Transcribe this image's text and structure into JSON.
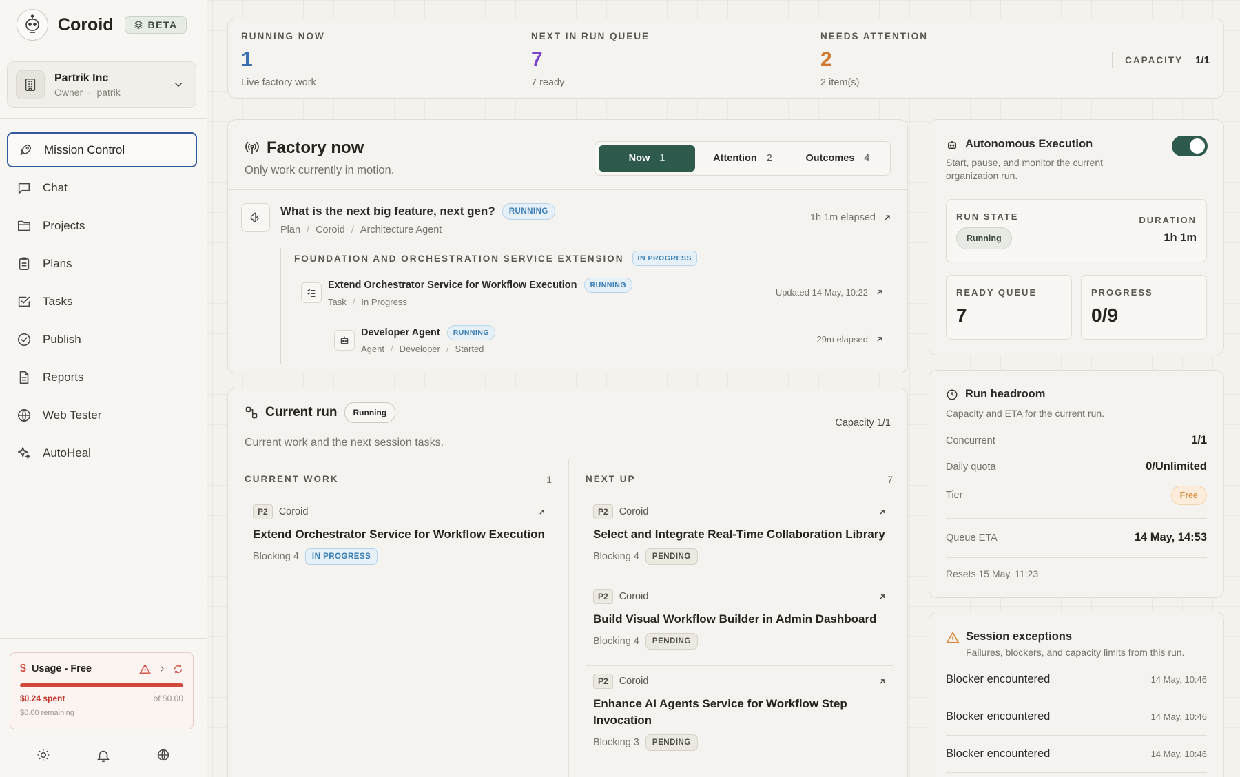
{
  "brand": {
    "name": "Coroid",
    "badge": "BETA"
  },
  "org": {
    "name": "Partrik Inc",
    "role": "Owner",
    "user": "patrik",
    "separator": "·"
  },
  "nav": [
    {
      "label": "Mission Control",
      "icon": "rocket-icon",
      "active": true
    },
    {
      "label": "Chat",
      "icon": "chat-icon"
    },
    {
      "label": "Projects",
      "icon": "folder-icon"
    },
    {
      "label": "Plans",
      "icon": "clipboard-icon"
    },
    {
      "label": "Tasks",
      "icon": "checkbox-icon"
    },
    {
      "label": "Publish",
      "icon": "badge-check-icon"
    },
    {
      "label": "Reports",
      "icon": "document-icon"
    },
    {
      "label": "Web Tester",
      "icon": "globe-icon"
    },
    {
      "label": "AutoHeal",
      "icon": "sparkle-icon"
    }
  ],
  "usage": {
    "title": "Usage - Free",
    "spent": "$0.24 spent",
    "of": "of $0.00",
    "remaining": "$0.00 remaining",
    "fill_percent": 100
  },
  "stats": {
    "running": {
      "label": "RUNNING NOW",
      "value": "1",
      "sub": "Live factory work",
      "color": "#3a6fb0"
    },
    "queue": {
      "label": "NEXT IN RUN QUEUE",
      "value": "7",
      "sub": "7 ready",
      "color": "#7b45c9"
    },
    "attention": {
      "label": "NEEDS ATTENTION",
      "value": "2",
      "sub": "2 item(s)",
      "color": "#d1792f"
    },
    "capacity": {
      "label": "CAPACITY",
      "value": "1/1"
    }
  },
  "factory": {
    "title": "Factory now",
    "subtitle": "Only work currently in motion.",
    "tabs": [
      {
        "label": "Now",
        "count": "1"
      },
      {
        "label": "Attention",
        "count": "2"
      },
      {
        "label": "Outcomes",
        "count": "4"
      }
    ],
    "plan": {
      "title": "What is the next big feature, next gen?",
      "status": "RUNNING",
      "crumbs": [
        "Plan",
        "Coroid",
        "Architecture Agent"
      ],
      "elapsed": "1h 1m elapsed"
    },
    "phase": {
      "title": "FOUNDATION AND ORCHESTRATION SERVICE EXTENSION",
      "status": "IN PROGRESS"
    },
    "task": {
      "title": "Extend Orchestrator Service for Workflow Execution",
      "status": "RUNNING",
      "crumbs": [
        "Task",
        "In Progress"
      ],
      "updated": "Updated 14 May, 10:22"
    },
    "agent": {
      "title": "Developer Agent",
      "status": "RUNNING",
      "crumbs": [
        "Agent",
        "Developer",
        "Started"
      ],
      "elapsed": "29m elapsed"
    }
  },
  "run": {
    "title": "Current run",
    "status": "Running",
    "subtitle": "Current work and the next session tasks.",
    "capacity": "Capacity 1/1",
    "current": {
      "label": "CURRENT WORK",
      "count": "1",
      "items": [
        {
          "priority": "P2",
          "project": "Coroid",
          "title": "Extend Orchestrator Service for Workflow Execution",
          "blocking": "Blocking 4",
          "status": "IN PROGRESS"
        }
      ]
    },
    "next": {
      "label": "NEXT UP",
      "count": "7",
      "items": [
        {
          "priority": "P2",
          "project": "Coroid",
          "title": "Select and Integrate Real-Time Collaboration Library",
          "blocking": "Blocking 4",
          "status": "PENDING"
        },
        {
          "priority": "P2",
          "project": "Coroid",
          "title": "Build Visual Workflow Builder in Admin Dashboard",
          "blocking": "Blocking 4",
          "status": "PENDING"
        },
        {
          "priority": "P2",
          "project": "Coroid",
          "title": "Enhance AI Agents Service for Workflow Step Invocation",
          "blocking": "Blocking 3",
          "status": "PENDING"
        }
      ]
    }
  },
  "auto": {
    "title": "Autonomous Execution",
    "subtitle": "Start, pause, and monitor the current organization run.",
    "toggle_on": true,
    "run_state_label": "RUN STATE",
    "run_state": "Running",
    "duration_label": "DURATION",
    "duration": "1h 1m",
    "ready_label": "READY QUEUE",
    "ready": "7",
    "progress_label": "PROGRESS",
    "progress": "0/9"
  },
  "headroom": {
    "title": "Run headroom",
    "subtitle": "Capacity and ETA for the current run.",
    "concurrent_label": "Concurrent",
    "concurrent": "1/1",
    "quota_label": "Daily quota",
    "quota": "0/Unlimited",
    "tier_label": "Tier",
    "tier": "Free",
    "eta_label": "Queue ETA",
    "eta": "14 May, 14:53",
    "resets": "Resets 15 May, 11:23"
  },
  "exceptions": {
    "title": "Session exceptions",
    "subtitle": "Failures, blockers, and capacity limits from this run.",
    "items": [
      {
        "title": "Blocker encountered",
        "time": "14 May, 10:46"
      },
      {
        "title": "Blocker encountered",
        "time": "14 May, 10:46"
      },
      {
        "title": "Blocker encountered",
        "time": "14 May, 10:46"
      }
    ]
  }
}
